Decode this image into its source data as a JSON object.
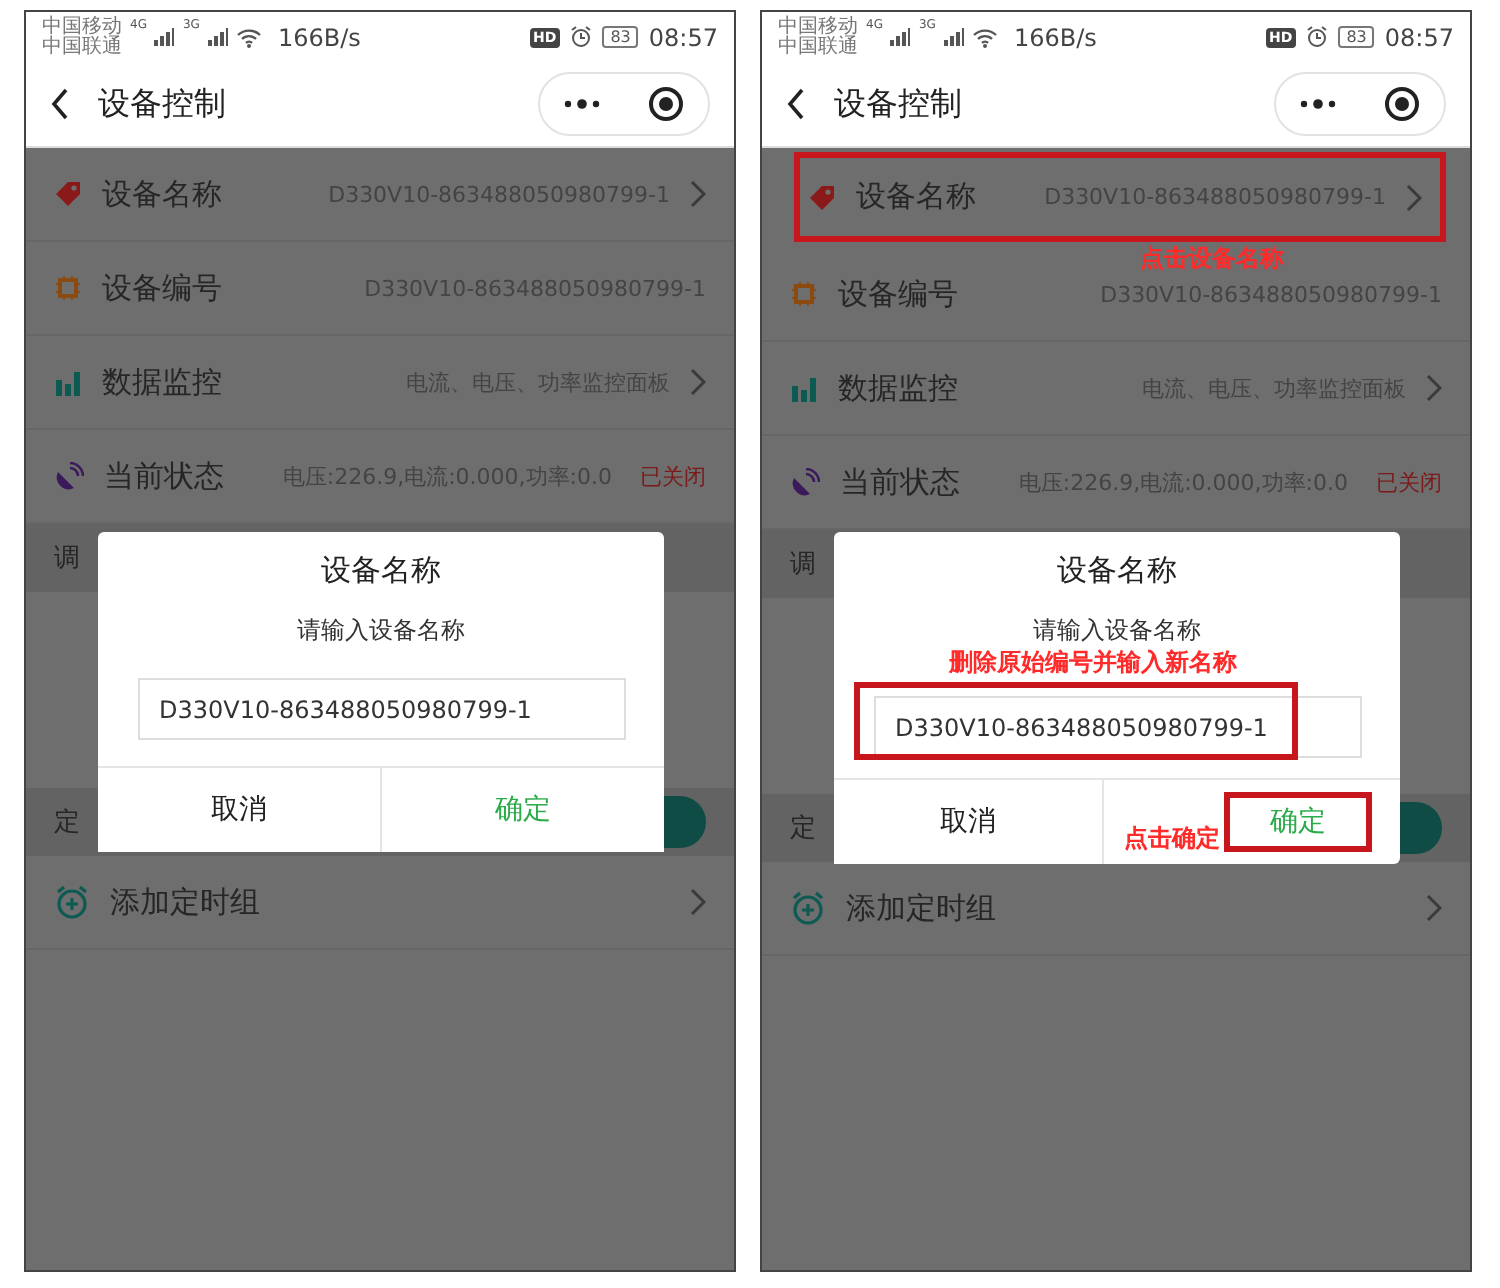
{
  "screens": [
    {
      "status_bar": {
        "carriers": [
          "中国移动",
          "中国联通"
        ],
        "networks": [
          "4G",
          "3G"
        ],
        "speed": "166B/s",
        "hd": "HD",
        "battery": "83",
        "time": "08:57"
      },
      "header": {
        "title": "设备控制"
      },
      "rows": [
        {
          "kind": "tag",
          "label": "设备名称",
          "value": "D330V10-863488050980799-1",
          "chevron": true,
          "highlighted": false
        },
        {
          "kind": "chip",
          "label": "设备编号",
          "value": "D330V10-863488050980799-1",
          "chevron": false,
          "highlighted": false
        },
        {
          "kind": "chart",
          "label": "数据监控",
          "value": "电流、电压、功率监控面板",
          "chevron": true,
          "highlighted": false
        },
        {
          "kind": "satellite",
          "label": "当前状态",
          "value": "电压:226.9,电流:0.000,功率:0.0",
          "status": "已关闭",
          "chevron": false,
          "highlighted": false
        }
      ],
      "sections": [
        {
          "label": "调"
        },
        {
          "label": "定"
        }
      ],
      "timer_row": {
        "label": "添加定时组"
      },
      "dialog": {
        "title": "设备名称",
        "prompt": "请输入设备名称",
        "input": {
          "value": "D330V10-863488050980799-1",
          "highlighted": false
        },
        "buttons": [
          {
            "kind": "cancel",
            "label": "取消",
            "highlighted": false
          },
          {
            "kind": "confirm",
            "label": "确定",
            "highlighted": false
          }
        ]
      }
    },
    {
      "status_bar": {
        "carriers": [
          "中国移动",
          "中国联通"
        ],
        "networks": [
          "4G",
          "3G"
        ],
        "speed": "166B/s",
        "hd": "HD",
        "battery": "83",
        "time": "08:57"
      },
      "header": {
        "title": "设备控制"
      },
      "rows": [
        {
          "kind": "tag",
          "label": "设备名称",
          "value": "D330V10-863488050980799-1",
          "chevron": true,
          "highlighted": true,
          "note": "点击设备名称"
        },
        {
          "kind": "chip",
          "label": "设备编号",
          "value": "D330V10-863488050980799-1",
          "chevron": false,
          "highlighted": false
        },
        {
          "kind": "chart",
          "label": "数据监控",
          "value": "电流、电压、功率监控面板",
          "chevron": true,
          "highlighted": false
        },
        {
          "kind": "satellite",
          "label": "当前状态",
          "value": "电压:226.9,电流:0.000,功率:0.0",
          "status": "已关闭",
          "chevron": false,
          "highlighted": false
        }
      ],
      "sections": [
        {
          "label": "调"
        },
        {
          "label": "定"
        }
      ],
      "timer_row": {
        "label": "添加定时组"
      },
      "dialog": {
        "title": "设备名称",
        "prompt": "请输入设备名称",
        "input": {
          "value": "D330V10-863488050980799-1",
          "highlighted": true,
          "note": "删除原始编号并输入新名称"
        },
        "buttons": [
          {
            "kind": "cancel",
            "label": "取消",
            "highlighted": false
          },
          {
            "kind": "confirm",
            "label": "确定",
            "highlighted": true,
            "note": "点击确定"
          }
        ]
      }
    }
  ]
}
